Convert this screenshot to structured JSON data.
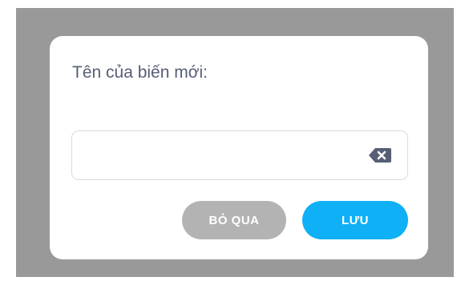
{
  "dialog": {
    "title": "Tên của biến mới:",
    "input": {
      "value": "",
      "placeholder": ""
    },
    "clear_icon": "clear-backspace-icon",
    "cancel_label": "BỎ QUA",
    "save_label": "LƯU"
  },
  "colors": {
    "backdrop": "#999999",
    "dialog_bg": "#ffffff",
    "title_text": "#575e75",
    "input_border": "#d7dbe3",
    "cancel_button": "#b3b3b3",
    "save_button": "#0fb0f5",
    "clear_icon": "#575e75"
  }
}
